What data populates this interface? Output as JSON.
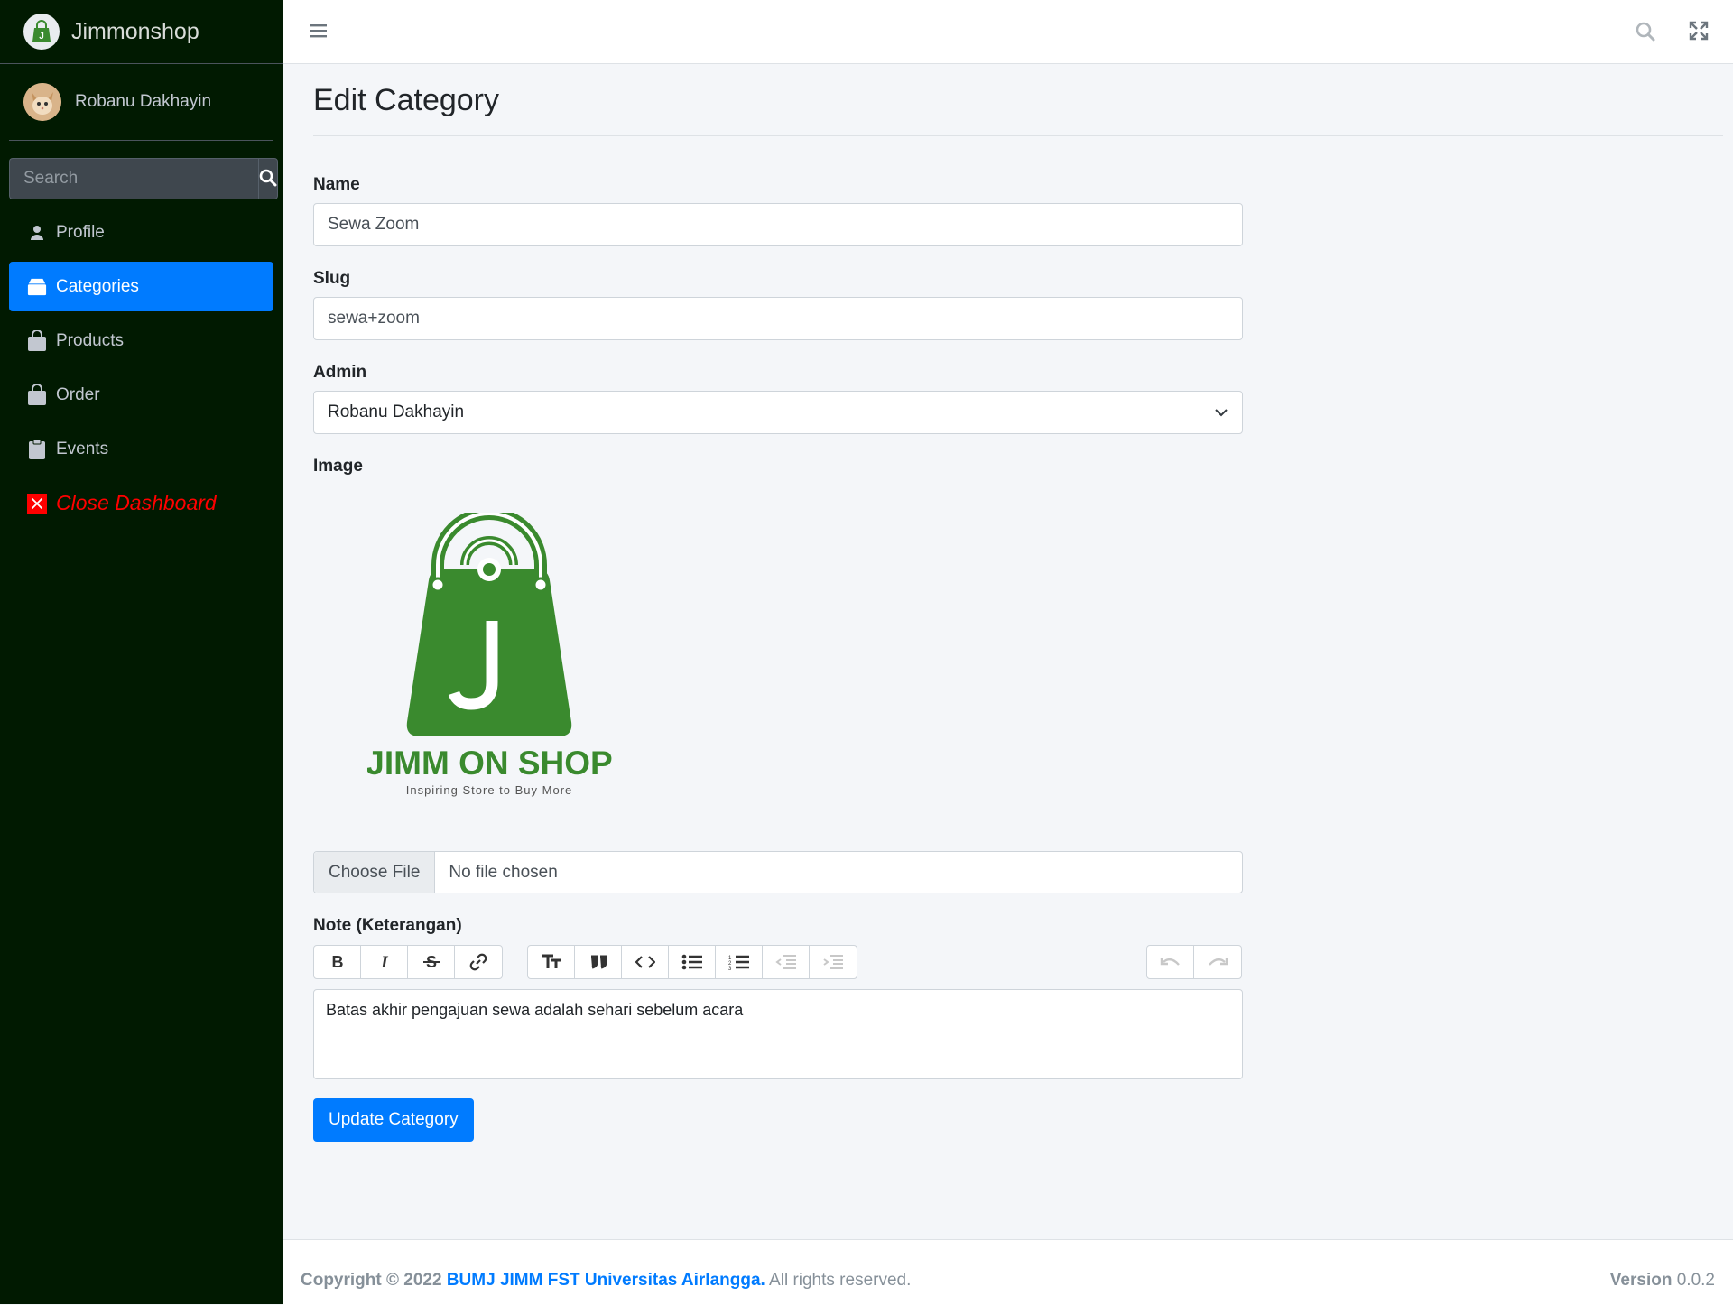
{
  "brand": {
    "name": "Jimmonshop"
  },
  "user": {
    "name": "Robanu Dakhayin"
  },
  "sidebar": {
    "search_placeholder": "Search",
    "items": [
      {
        "label": "Profile",
        "icon": "user-icon"
      },
      {
        "label": "Categories",
        "icon": "box-icon",
        "active": true
      },
      {
        "label": "Products",
        "icon": "shopping-bag-icon"
      },
      {
        "label": "Order",
        "icon": "shopping-bag-icon"
      },
      {
        "label": "Events",
        "icon": "clipboard-icon"
      },
      {
        "label": "Close Dashboard",
        "icon": "close-icon"
      }
    ]
  },
  "page": {
    "title": "Edit Category"
  },
  "form": {
    "name_label": "Name",
    "name_value": "Sewa Zoom",
    "slug_label": "Slug",
    "slug_value": "sewa+zoom",
    "admin_label": "Admin",
    "admin_value": "Robanu Dakhayin",
    "image_label": "Image",
    "logo_title": "JIMM ON SHOP",
    "logo_tagline": "Inspiring Store to Buy More",
    "file_button": "Choose File",
    "file_status": "No file chosen",
    "note_label": "Note (Keterangan)",
    "note_value": "Batas akhir pengajuan sewa adalah sehari sebelum acara",
    "submit_label": "Update Category"
  },
  "footer": {
    "copyright_prefix": "Copyright © 2022",
    "org": "BUMJ JIMM FST Universitas Airlangga.",
    "rights": "All rights reserved.",
    "version_label": "Version",
    "version_value": "0.0.2"
  },
  "colors": {
    "sidebar_bg": "#011a01",
    "accent": "#007bff",
    "danger": "#ff0000",
    "logo_green": "#3a8a2e"
  }
}
